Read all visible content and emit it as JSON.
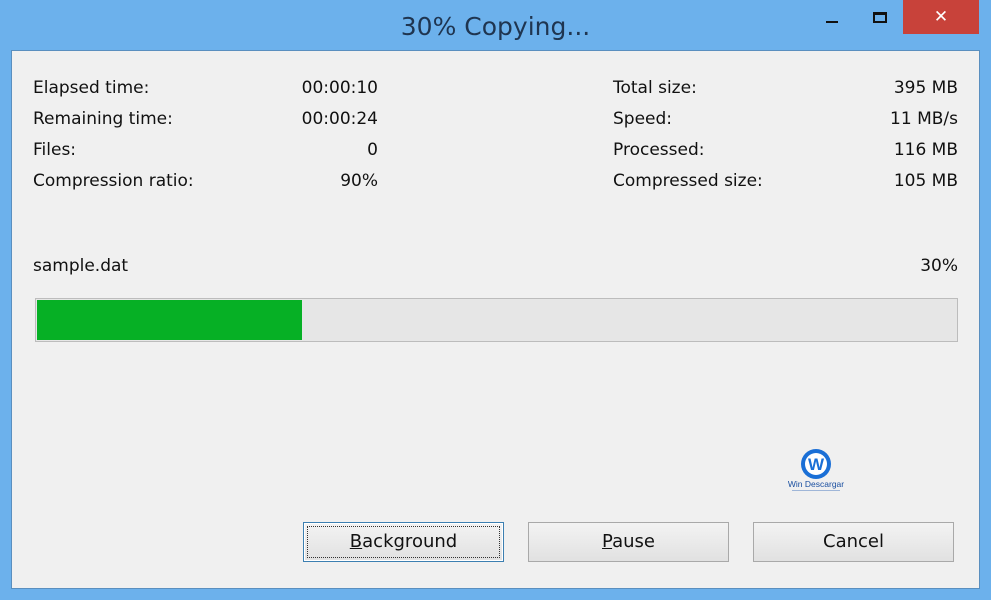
{
  "window": {
    "title": "30% Copying...",
    "close_glyph": "✕"
  },
  "stats_left": [
    {
      "label": "Elapsed time:",
      "value": "00:00:10"
    },
    {
      "label": "Remaining time:",
      "value": "00:00:24"
    },
    {
      "label": "Files:",
      "value": "0"
    },
    {
      "label": "Compression ratio:",
      "value": "90%"
    }
  ],
  "stats_right": [
    {
      "label": "Total size:",
      "value": "395 MB"
    },
    {
      "label": "Speed:",
      "value": "11 MB/s"
    },
    {
      "label": "Processed:",
      "value": "116 MB"
    },
    {
      "label": "Compressed size:",
      "value": "105 MB"
    }
  ],
  "current_file": {
    "name": "sample.dat",
    "percent_text": "30%",
    "progress": 0.29
  },
  "logo": {
    "text": "Win Descargar",
    "letter": "W"
  },
  "buttons": {
    "background": {
      "access": "B",
      "rest": "ackground"
    },
    "pause": {
      "access": "P",
      "rest": "ause"
    },
    "cancel": {
      "label": "Cancel"
    }
  },
  "colors": {
    "titlebar": "#6cb1ec",
    "close": "#c8423a",
    "progress_fill": "#06b025"
  }
}
